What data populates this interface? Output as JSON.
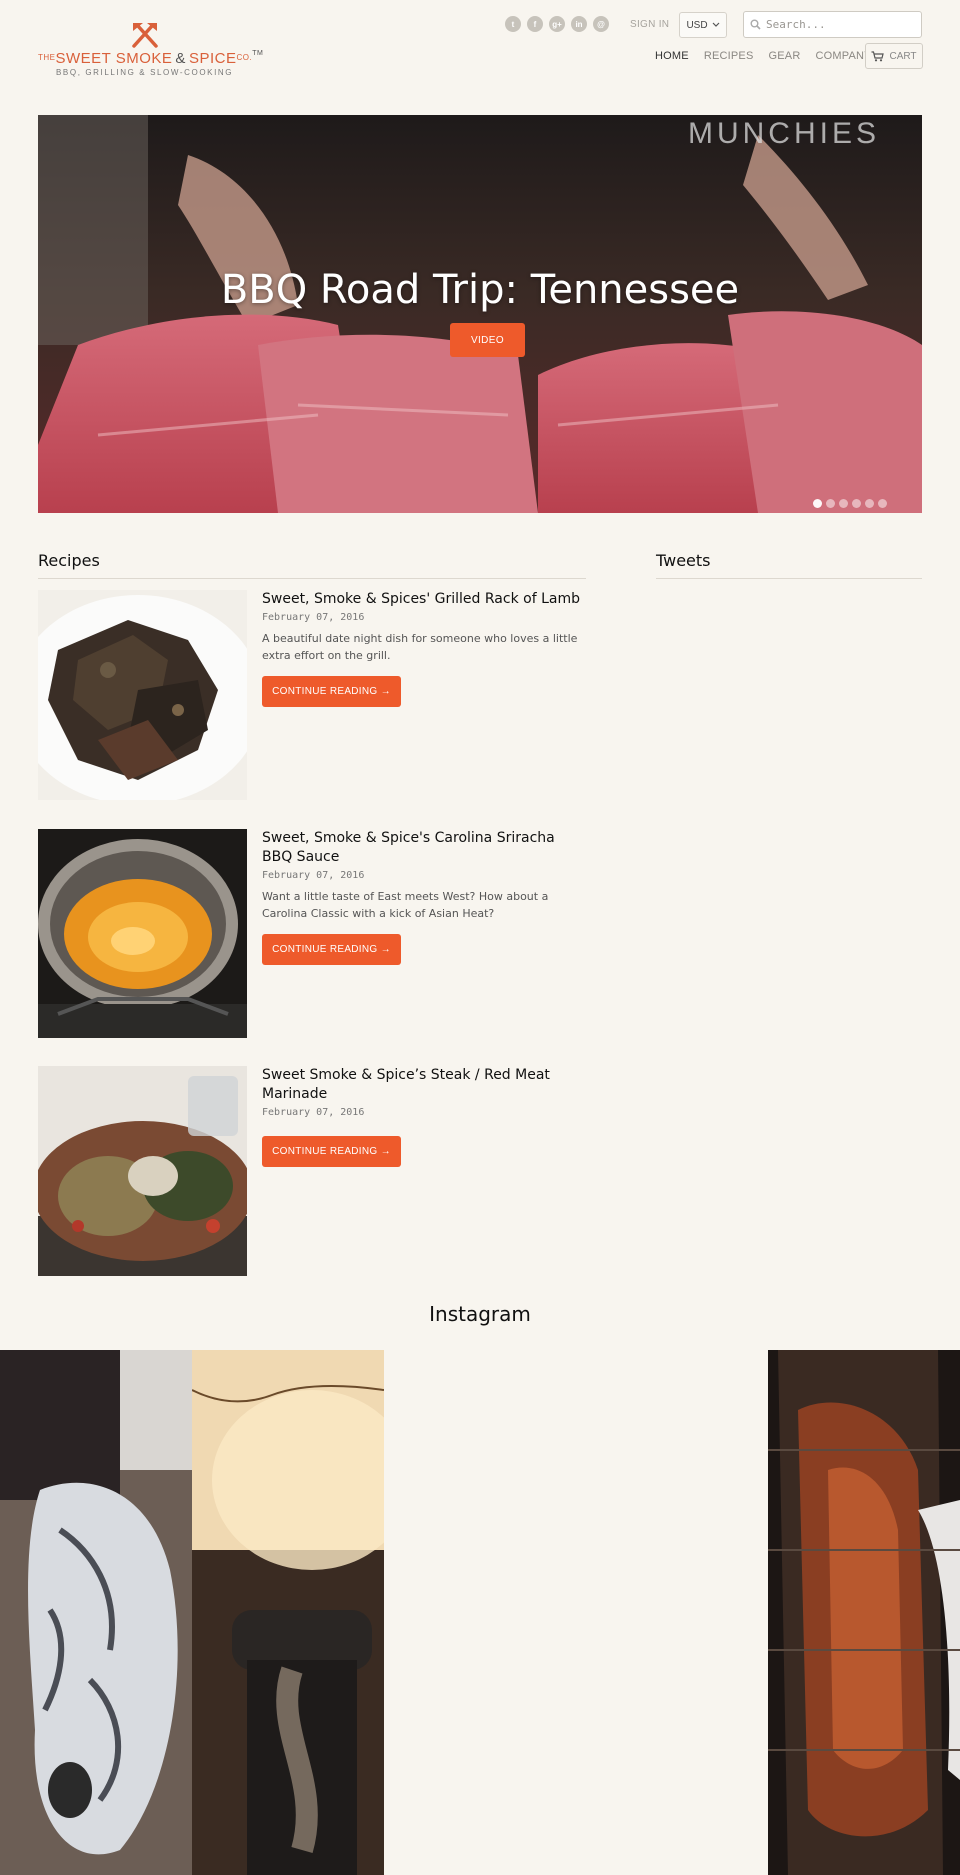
{
  "header": {
    "logo": {
      "the": "THE",
      "name1": "SWEET SMOKE",
      "amp": "&",
      "name2": "SPICE",
      "co": "CO.",
      "tm": "TM",
      "tagline": "BBQ, GRILLING & SLOW-COOKING"
    },
    "social_icons": [
      "twitter-icon",
      "facebook-icon",
      "google-plus-icon",
      "linkedin-icon",
      "email-icon"
    ],
    "social_glyphs": [
      "t",
      "f",
      "g+",
      "in",
      "@"
    ],
    "sign_in": "SIGN IN",
    "currency": "USD",
    "search_placeholder": "Search...",
    "nav": [
      "HOME",
      "RECIPES",
      "GEAR",
      "COMPANY"
    ],
    "cart": "CART"
  },
  "hero": {
    "watermark": "MUNCHIES",
    "title": "BBQ Road Trip: Tennessee",
    "button": "VIDEO",
    "slides": 6,
    "active_slide": 1
  },
  "recipes": {
    "heading": "Recipes",
    "posts": [
      {
        "title": "Sweet, Smoke & Spices' Grilled Rack of Lamb",
        "date": "February 07, 2016",
        "excerpt": "A beautiful date night dish for someone who loves a little extra effort on the grill.",
        "button": "CONTINUE READING →"
      },
      {
        "title": "Sweet, Smoke & Spice's Carolina Sriracha BBQ Sauce",
        "date": "February 07, 2016",
        "excerpt": "Want a little taste of East meets West? How about a Carolina Classic with a kick of Asian Heat?",
        "button": "CONTINUE READING →"
      },
      {
        "title": "Sweet Smoke & Spice’s Steak / Red Meat Marinade",
        "date": "February 07, 2016",
        "excerpt": "",
        "button": "CONTINUE READING →"
      }
    ]
  },
  "tweets": {
    "heading": "Tweets"
  },
  "instagram": {
    "heading": "Instagram"
  },
  "colors": {
    "accent": "#ee5a2b",
    "background": "#f8f5ef",
    "brand": "#d9603a"
  }
}
